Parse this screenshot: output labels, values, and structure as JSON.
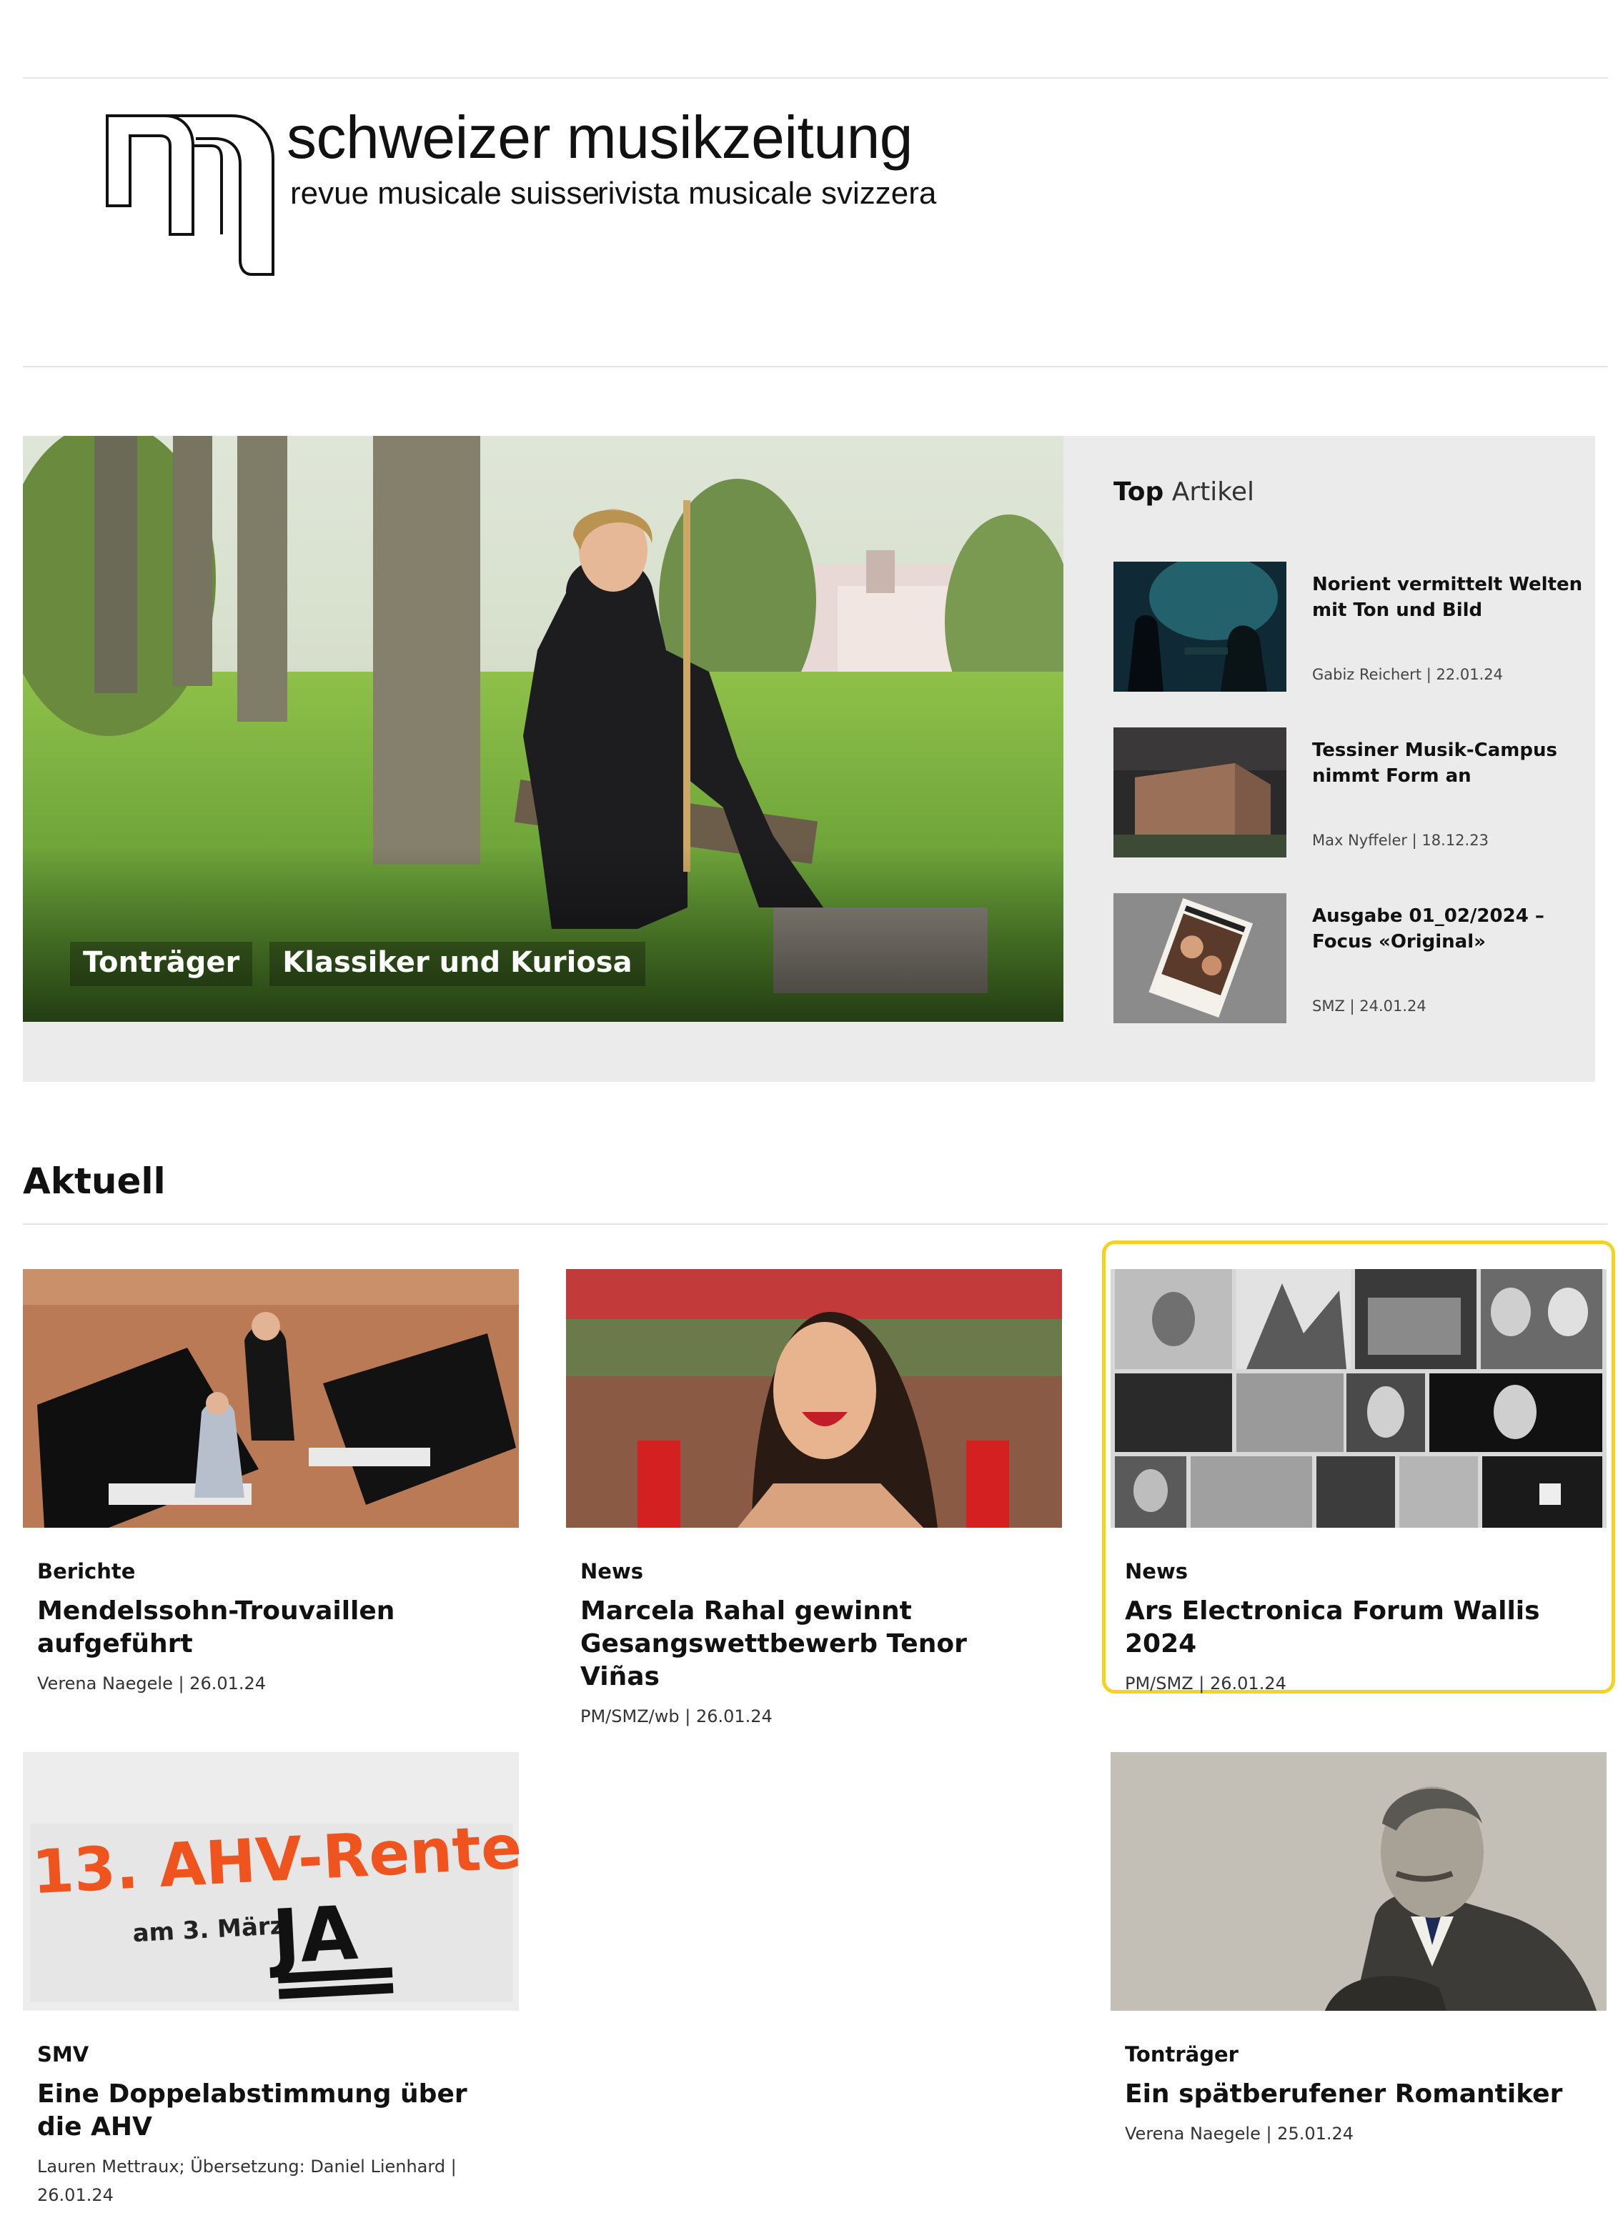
{
  "logo": {
    "title": "schweizer musikzeitung",
    "subtitle_fr": "revue musicale suisse",
    "subtitle_it": "rivista musicale svizzera"
  },
  "hero": {
    "tags": [
      "Tonträger",
      "Klassiker und Kuriosa"
    ]
  },
  "top_articles": {
    "heading_bold": "Top",
    "heading_light": "Artikel",
    "items": [
      {
        "title": "Norient vermittelt Welten mit Ton und Bild",
        "meta": "Gabiz Reichert | 22.01.24"
      },
      {
        "title": "Tessiner Musik-Campus nimmt Form an",
        "meta": "Max Nyffeler | 18.12.23"
      },
      {
        "title": "Ausgabe 01_02/2024 – Focus «Original»",
        "meta": "SMZ | 24.01.24"
      }
    ]
  },
  "aktuell": {
    "heading": "Aktuell",
    "cards": [
      {
        "category": "Berichte",
        "title": "Mendelssohn-Trouvaillen aufgeführt",
        "meta": "Verena Naegele | 26.01.24"
      },
      {
        "category": "News",
        "title": "Marcela Rahal gewinnt Gesangswettbewerb Tenor Viñas",
        "meta": "PM/SMZ/wb | 26.01.24"
      },
      {
        "category": "News",
        "title": "Ars Electronica Forum Wallis 2024",
        "meta": "PM/SMZ | 26.01.24"
      },
      {
        "category": "SMV",
        "title": "Eine Doppelabstimmung über die AHV",
        "meta": "Lauren Mettraux; Übersetzung: Daniel Lienhard | 26.01.24"
      },
      {
        "category": "Tonträger",
        "title": "Ein spätberufener Romantiker",
        "meta": "Verena Naegele | 25.01.24"
      }
    ]
  },
  "ahv_banner": {
    "line1": "13. AHV-Rente",
    "line2": "am 3. März",
    "line3": "JA"
  },
  "colors": {
    "highlight": "#f4d21e",
    "ahv_orange": "#f0541e",
    "panel_grey": "#ebebeb"
  }
}
